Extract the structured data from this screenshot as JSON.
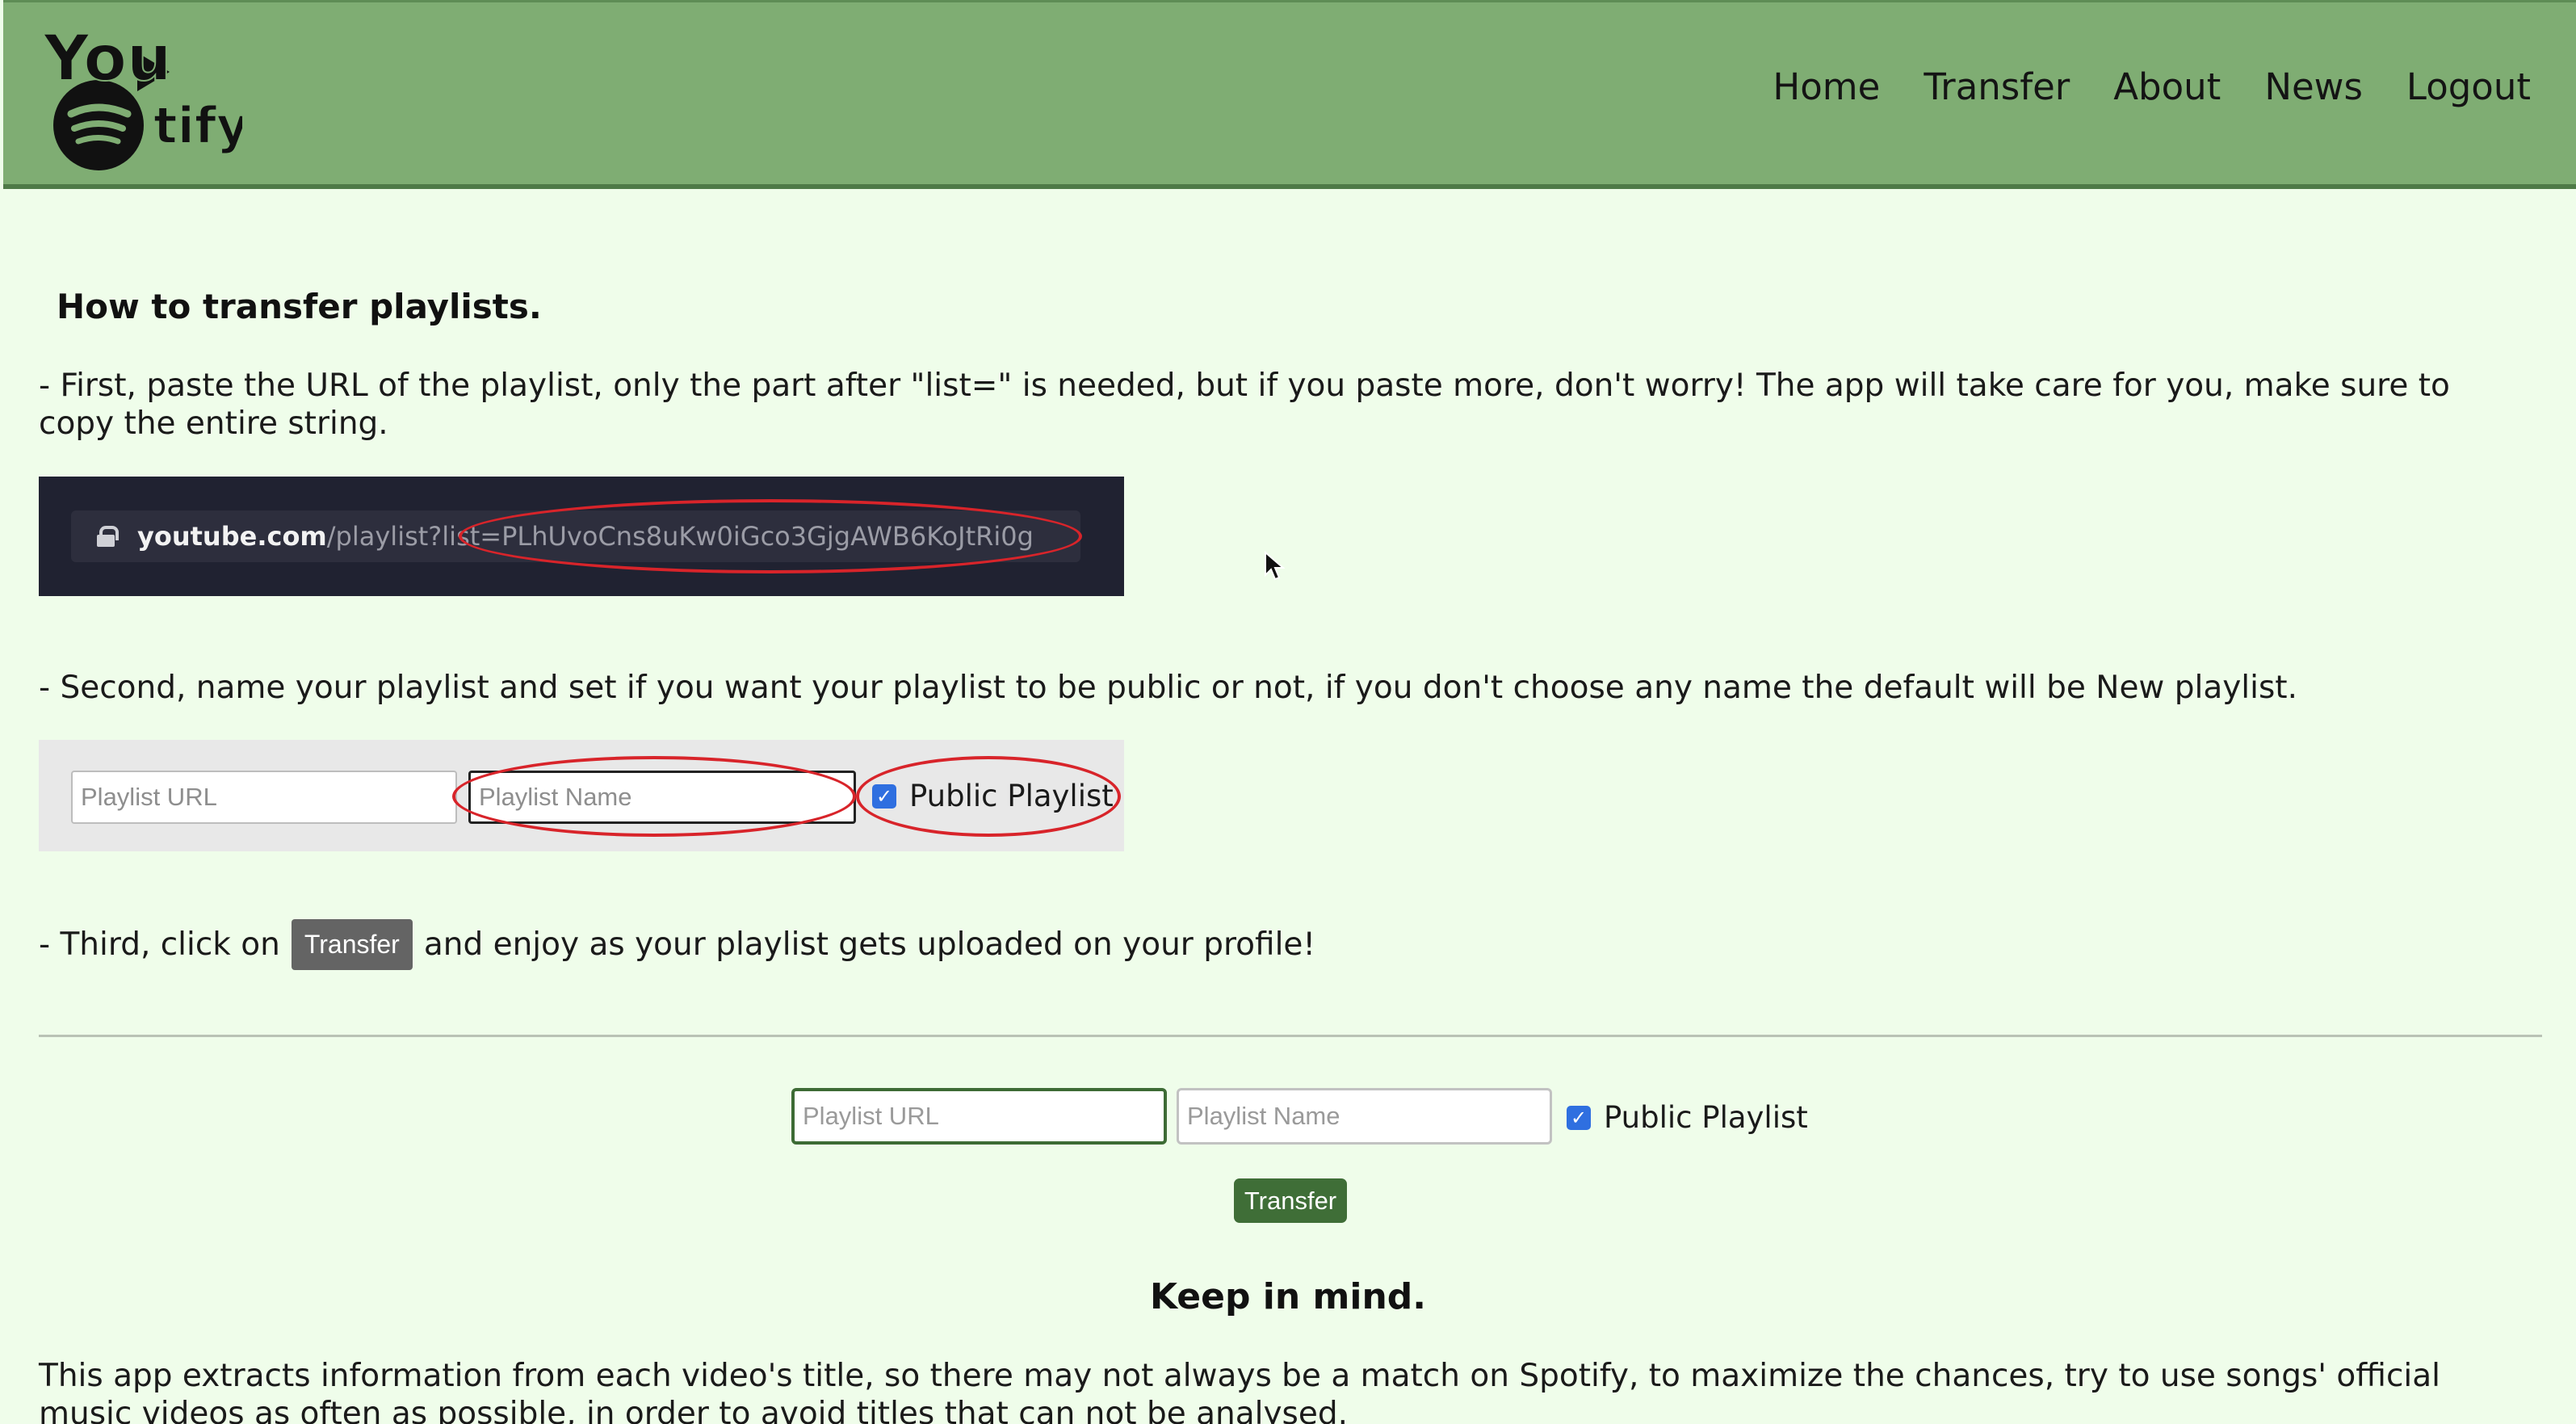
{
  "header": {
    "logo_text": "YouTify",
    "nav": [
      "Home",
      "Transfer",
      "About",
      "News",
      "Logout"
    ]
  },
  "instructions": {
    "title": "How to transfer playlists.",
    "step1": "- First, paste the URL of the playlist, only the part after \"list=\" is needed, but if you paste more, don't worry! The app will take care for you, make sure to copy the entire string.",
    "step1_screenshot": {
      "domain": "youtube.com",
      "path": "/playlist?list=",
      "playlist_id": "PLhUvoCns8uKw0iGco3GjgAWB6KoJtRi0g"
    },
    "step2": "- Second, name your playlist and set if you want your playlist to be public or not, if you don't choose any name the default will be New playlist.",
    "step2_screenshot": {
      "url_placeholder": "Playlist URL",
      "name_placeholder": "Playlist Name",
      "public_label": "Public Playlist"
    },
    "step3_before": "- Third, click on",
    "step3_button": "Transfer",
    "step3_after": "and enjoy as your playlist gets uploaded on your profile!"
  },
  "form": {
    "url_placeholder": "Playlist URL",
    "url_value": "",
    "name_placeholder": "Playlist Name",
    "name_value": "",
    "public_label": "Public Playlist",
    "public_checked": true,
    "submit_label": "Transfer"
  },
  "notes": {
    "title": "Keep in mind.",
    "text": "This app extracts information from each video's title, so there may not always be a match on Spotify, to maximize the chances, try to use songs' official music videos as often as possible, in order to avoid titles that can not be analysed."
  },
  "colors": {
    "header_bg": "#7fad73",
    "page_bg": "#effdea",
    "accent": "#3f6e37",
    "annotation": "#d8242a",
    "checkbox": "#2f6fe0"
  }
}
